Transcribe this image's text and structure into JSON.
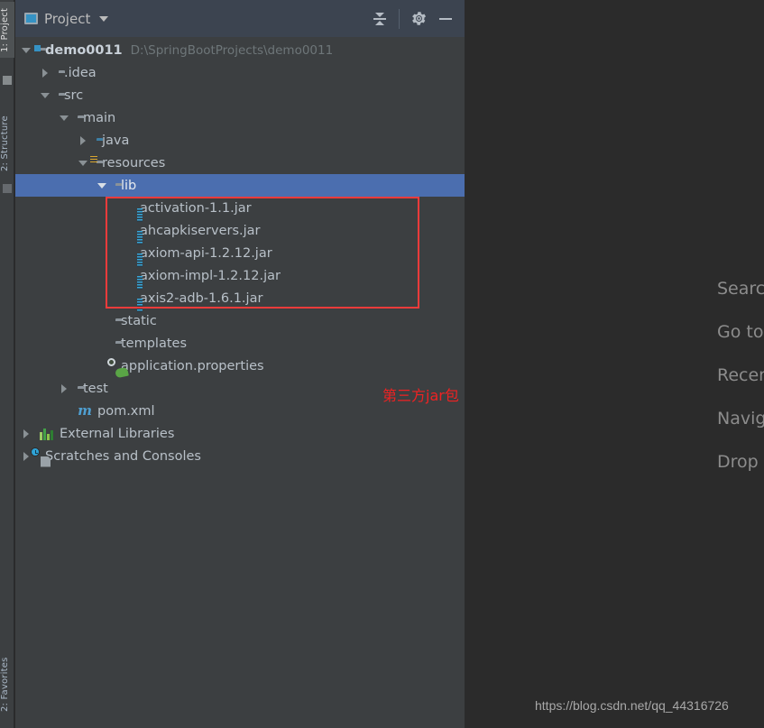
{
  "stripe": {
    "tabs": [
      {
        "label": "1: Project",
        "active": true
      },
      {
        "label": "2: Structure",
        "active": false
      },
      {
        "label": "2: Favorites",
        "active": false
      }
    ]
  },
  "toolwindow": {
    "title": "Project",
    "actions": [
      {
        "name": "collapse-all",
        "tooltip": "Collapse All"
      },
      {
        "name": "settings",
        "tooltip": "Settings"
      },
      {
        "name": "hide",
        "tooltip": "Hide"
      }
    ]
  },
  "tree": {
    "nodes": [
      {
        "label": "demo0011",
        "sub": "D:\\SpringBootProjects\\demo0011",
        "indent": 0,
        "twisty": "open",
        "icon": "module-folder",
        "bold": true,
        "selected": false
      },
      {
        "label": ".idea",
        "sub": "",
        "indent": 1,
        "twisty": "closed",
        "icon": "folder",
        "bold": false,
        "selected": false
      },
      {
        "label": "src",
        "sub": "",
        "indent": 1,
        "twisty": "open",
        "icon": "folder",
        "bold": false,
        "selected": false
      },
      {
        "label": "main",
        "sub": "",
        "indent": 2,
        "twisty": "open",
        "icon": "folder",
        "bold": false,
        "selected": false
      },
      {
        "label": "java",
        "sub": "",
        "indent": 3,
        "twisty": "closed",
        "icon": "source-folder",
        "bold": false,
        "selected": false
      },
      {
        "label": "resources",
        "sub": "",
        "indent": 3,
        "twisty": "open",
        "icon": "resource-folder",
        "bold": false,
        "selected": false
      },
      {
        "label": "lib",
        "sub": "",
        "indent": 4,
        "twisty": "open",
        "icon": "folder",
        "bold": false,
        "selected": true
      },
      {
        "label": "activation-1.1.jar",
        "sub": "",
        "indent": 5,
        "twisty": "none",
        "icon": "jar",
        "bold": false,
        "selected": false
      },
      {
        "label": "ahcapkiservers.jar",
        "sub": "",
        "indent": 5,
        "twisty": "none",
        "icon": "jar",
        "bold": false,
        "selected": false
      },
      {
        "label": "axiom-api-1.2.12.jar",
        "sub": "",
        "indent": 5,
        "twisty": "none",
        "icon": "jar",
        "bold": false,
        "selected": false
      },
      {
        "label": "axiom-impl-1.2.12.jar",
        "sub": "",
        "indent": 5,
        "twisty": "none",
        "icon": "jar",
        "bold": false,
        "selected": false
      },
      {
        "label": "axis2-adb-1.6.1.jar",
        "sub": "",
        "indent": 5,
        "twisty": "none",
        "icon": "jar",
        "bold": false,
        "selected": false
      },
      {
        "label": "static",
        "sub": "",
        "indent": 4,
        "twisty": "none",
        "icon": "folder",
        "bold": false,
        "selected": false
      },
      {
        "label": "templates",
        "sub": "",
        "indent": 4,
        "twisty": "none",
        "icon": "folder",
        "bold": false,
        "selected": false
      },
      {
        "label": "application.properties",
        "sub": "",
        "indent": 4,
        "twisty": "none",
        "icon": "spring-leaf",
        "bold": false,
        "selected": false
      },
      {
        "label": "test",
        "sub": "",
        "indent": 2,
        "twisty": "closed",
        "icon": "folder",
        "bold": false,
        "selected": false
      },
      {
        "label": "pom.xml",
        "sub": "",
        "indent": 2,
        "twisty": "none",
        "icon": "maven",
        "bold": false,
        "selected": false
      },
      {
        "label": "External Libraries",
        "sub": "",
        "indent": 0,
        "twisty": "closed",
        "icon": "libraries",
        "bold": false,
        "selected": false
      },
      {
        "label": "Scratches and Consoles",
        "sub": "",
        "indent": 0,
        "twisty": "closed",
        "icon": "scratches",
        "bold": false,
        "selected": false
      }
    ]
  },
  "annotation": {
    "note": "第三方jar包",
    "box_color": "#f03b3b",
    "text_color": "#f02222"
  },
  "editor": {
    "hints": [
      "Search Everywhere",
      "Go to File",
      "Recent Files",
      "Navigation Bar",
      "Drop files here to open them"
    ],
    "watermark": "https://blog.csdn.net/qq_44316726"
  },
  "colors": {
    "panel_bg": "#3c3f41",
    "editor_bg": "#2b2b2b",
    "header_bg": "#3c4450",
    "selection": "#4b6eaf",
    "text": "#a9b7c6",
    "accent_blue": "#3592c4"
  }
}
